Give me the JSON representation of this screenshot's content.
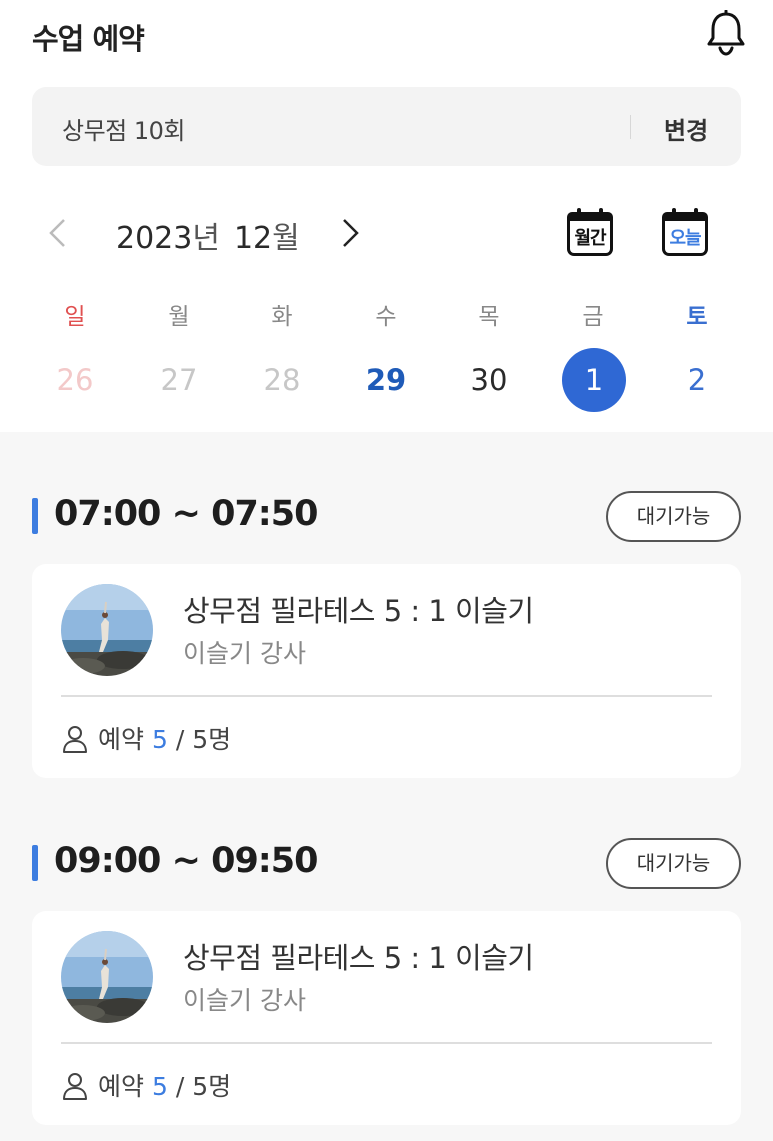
{
  "header": {
    "title": "수업 예약",
    "bell_icon": "bell-icon"
  },
  "ticket": {
    "name": "상무점 10회",
    "change_label": "변경"
  },
  "calendar": {
    "year": "2023",
    "year_unit": "년",
    "month": "12",
    "month_unit": "월",
    "month_view_label": "월간",
    "today_label": "오늘",
    "weekdays": [
      "일",
      "월",
      "화",
      "수",
      "목",
      "금",
      "토"
    ],
    "days": [
      "26",
      "27",
      "28",
      "29",
      "30",
      "1",
      "2"
    ]
  },
  "slots": [
    {
      "time": "07:00 ~ 07:50",
      "status": "대기가능",
      "class_name": "상무점 필라테스 5 : 1 이슬기",
      "teacher": "이슬기 강사",
      "booking_label": "예약",
      "booked": "5",
      "capacity": "/ 5명"
    },
    {
      "time": "09:00 ~ 09:50",
      "status": "대기가능",
      "class_name": "상무점 필라테스 5 : 1 이슬기",
      "teacher": "이슬기 강사",
      "booking_label": "예약",
      "booked": "5",
      "capacity": "/ 5명"
    }
  ],
  "colors": {
    "accent": "#3d7de0",
    "selected_day": "#2f68d4",
    "sunday": "#e05050",
    "saturday": "#3a6fd0"
  }
}
